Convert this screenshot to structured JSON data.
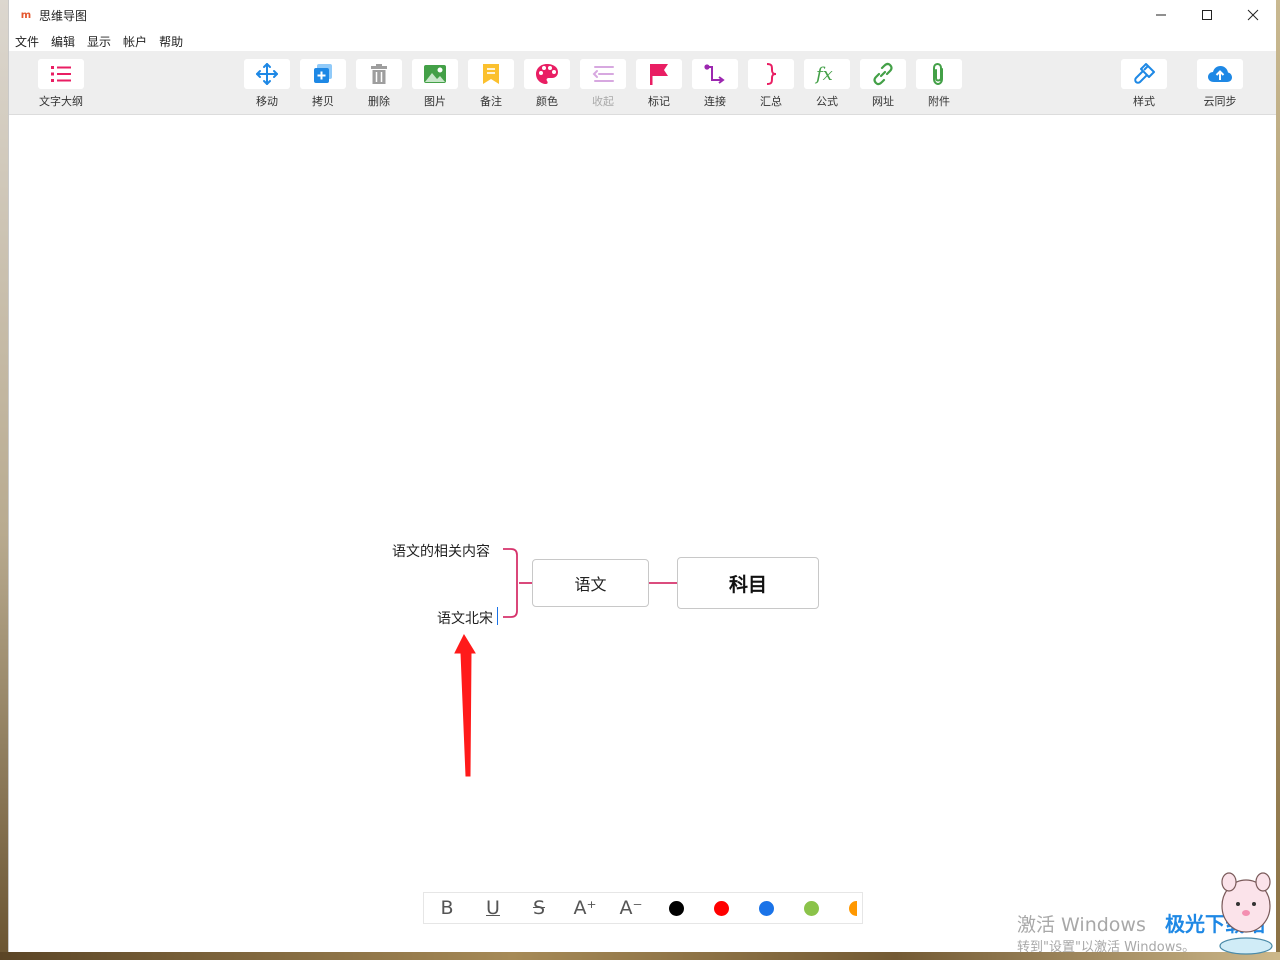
{
  "window": {
    "title": "思维导图",
    "logo_glyph": "m",
    "controls": {
      "minimize": "—",
      "maximize": "☐",
      "close": "✕"
    }
  },
  "menubar": {
    "items": [
      {
        "label": "文件"
      },
      {
        "label": "编辑"
      },
      {
        "label": "显示"
      },
      {
        "label": "帐户"
      },
      {
        "label": "帮助"
      }
    ]
  },
  "toolbar": {
    "outline": {
      "label": "文字大纲",
      "icon": "list-icon",
      "color": "#e91e63"
    },
    "tools": [
      {
        "key": "move",
        "label": "移动",
        "icon": "move-arrows-icon",
        "color": "#1e88e5",
        "enabled": true
      },
      {
        "key": "copy",
        "label": "拷贝",
        "icon": "copy-icon",
        "color": "#1e88e5",
        "enabled": true
      },
      {
        "key": "delete",
        "label": "删除",
        "icon": "trash-icon",
        "color": "#9e9e9e",
        "enabled": true
      },
      {
        "key": "image",
        "label": "图片",
        "icon": "image-icon",
        "color": "#43a047",
        "enabled": true
      },
      {
        "key": "note",
        "label": "备注",
        "icon": "note-icon",
        "color": "#fbc02d",
        "enabled": true
      },
      {
        "key": "color",
        "label": "颜色",
        "icon": "palette-icon",
        "color": "#e91e63",
        "enabled": true
      },
      {
        "key": "collapse",
        "label": "收起",
        "icon": "collapse-icon",
        "color": "#d7a8e0",
        "enabled": false
      },
      {
        "key": "flag",
        "label": "标记",
        "icon": "flag-icon",
        "color": "#e91e63",
        "enabled": true
      },
      {
        "key": "connect",
        "label": "连接",
        "icon": "connect-icon",
        "color": "#9c27b0",
        "enabled": true
      },
      {
        "key": "summary",
        "label": "汇总",
        "icon": "brace-icon",
        "color": "#e91e63",
        "enabled": true
      },
      {
        "key": "formula",
        "label": "公式",
        "icon": "fx-icon",
        "color": "#43a047",
        "enabled": true
      },
      {
        "key": "url",
        "label": "网址",
        "icon": "link-icon",
        "color": "#43a047",
        "enabled": true
      },
      {
        "key": "attach",
        "label": "附件",
        "icon": "paperclip-icon",
        "color": "#43a047",
        "enabled": true
      }
    ],
    "style": {
      "label": "样式",
      "icon": "brush-icon",
      "color": "#1e88e5"
    },
    "sync": {
      "label": "云同步",
      "icon": "cloud-upload-icon",
      "color": "#1e88e5"
    }
  },
  "mindmap": {
    "root": {
      "label": "科目"
    },
    "child": {
      "label": "语文"
    },
    "leaves": [
      {
        "label": "语文的相关内容"
      },
      {
        "label": "语文北宋"
      }
    ],
    "line_color": "#d6336c"
  },
  "formatbar": {
    "buttons": [
      {
        "key": "bold",
        "glyph": "B"
      },
      {
        "key": "underline",
        "glyph": "U"
      },
      {
        "key": "strikethrough",
        "glyph": "S"
      },
      {
        "key": "font-increase",
        "glyph": "A⁺"
      },
      {
        "key": "font-decrease",
        "glyph": "A⁻"
      }
    ],
    "colors": [
      "#000000",
      "#ff0000",
      "#1a73e8",
      "#8bc34a",
      "#ff9800"
    ]
  },
  "watermark": {
    "line1": "激活 Windows",
    "line2": "转到\"设置\"以激活 Windows。",
    "brand": "极光下载站"
  }
}
